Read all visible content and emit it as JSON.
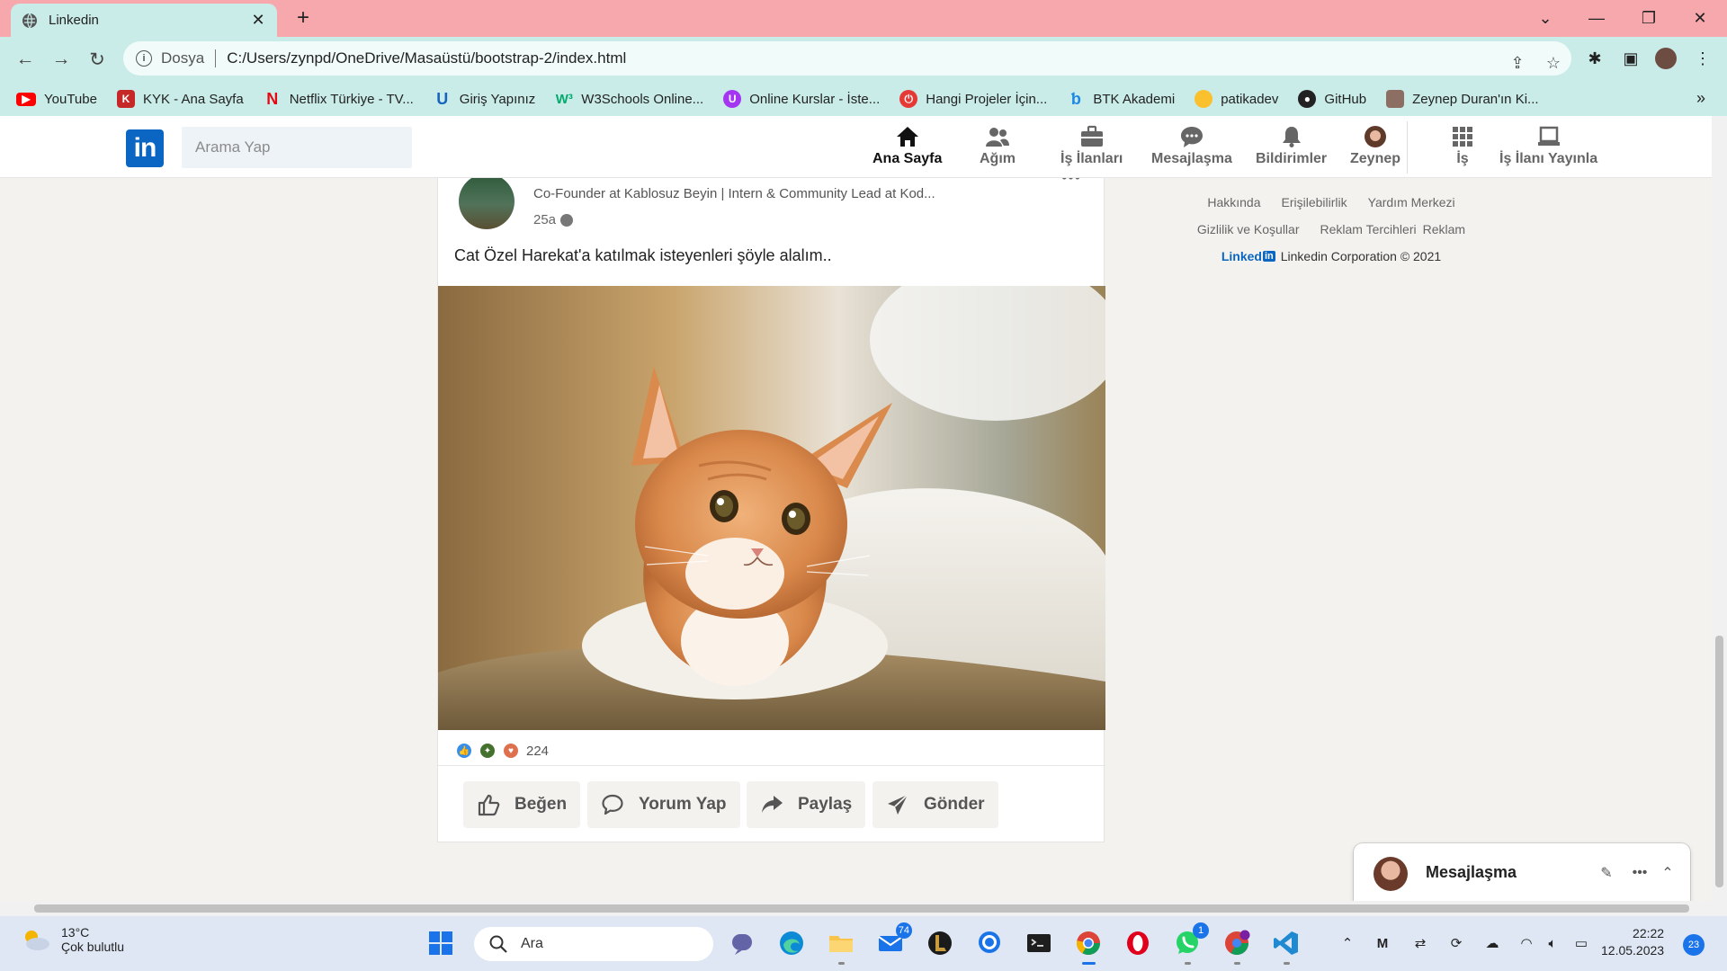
{
  "browser": {
    "tab_title": "Linkedin",
    "address_scheme": "Dosya",
    "address_url": "C:/Users/zynpd/OneDrive/Masaüstü/bootstrap-2/index.html"
  },
  "bookmarks": [
    {
      "label": "YouTube",
      "icon": "youtube-icon",
      "color": "#ff0000"
    },
    {
      "label": "KYK - Ana Sayfa",
      "icon": "kyk-icon",
      "color": "#c62828"
    },
    {
      "label": "Netflix Türkiye - TV...",
      "icon": "netflix-icon",
      "color": "#e50914"
    },
    {
      "label": "Giriş Yapınız",
      "icon": "udemy-icon",
      "color": "#1565c0"
    },
    {
      "label": "W3Schools Online...",
      "icon": "w3schools-icon",
      "color": "#04aa6d"
    },
    {
      "label": "Online Kurslar - İste...",
      "icon": "udemy-purple-icon",
      "color": "#a435f0"
    },
    {
      "label": "Hangi Projeler İçin...",
      "icon": "power-icon",
      "color": "#e53935"
    },
    {
      "label": "BTK Akademi",
      "icon": "btk-icon",
      "color": "#1e88e5"
    },
    {
      "label": "patikadev",
      "icon": "patika-icon",
      "color": "#fbc02d"
    },
    {
      "label": "GitHub",
      "icon": "github-icon",
      "color": "#222222"
    },
    {
      "label": "Zeynep Duran'ın Ki...",
      "icon": "profile-icon",
      "color": "#8d6e63"
    }
  ],
  "linkedin": {
    "search_placeholder": "Arama Yap",
    "nav": [
      {
        "label": "Ana Sayfa",
        "icon": "home-icon"
      },
      {
        "label": "Ağım",
        "icon": "network-icon"
      },
      {
        "label": "İş İlanları",
        "icon": "briefcase-icon"
      },
      {
        "label": "Mesajlaşma",
        "icon": "messaging-icon"
      },
      {
        "label": "Bildirimler",
        "icon": "bell-icon"
      },
      {
        "label": "Zeynep",
        "icon": "avatar-icon"
      },
      {
        "label": "İş",
        "icon": "grid-icon"
      },
      {
        "label": "İş İlanı Yayınla",
        "icon": "laptop-icon"
      }
    ],
    "post": {
      "author_subtitle": "Co-Founder at Kablosuz Beyin | Intern & Community Lead at Kod...",
      "time": "25a",
      "text": "Cat Özel Harekat'a katılmak isteyenleri şöyle alalım..",
      "reaction_count": "224",
      "actions": [
        {
          "label": "Beğen",
          "icon": "like-icon"
        },
        {
          "label": "Yorum Yap",
          "icon": "comment-icon"
        },
        {
          "label": "Paylaş",
          "icon": "share-icon"
        },
        {
          "label": "Gönder",
          "icon": "send-icon"
        }
      ]
    },
    "footer": {
      "links_row1": [
        "Hakkında",
        "Erişilebilirlik",
        "Yardım Merkezi"
      ],
      "links_row2": [
        "Gizlilik ve Koşullar",
        "Reklam Tercihleri",
        "Reklam"
      ],
      "brand": "Linked",
      "brand_in": "in",
      "copyright": "Linkedin Corporation © 2021"
    },
    "messaging_dock": {
      "title": "Mesajlaşma"
    }
  },
  "taskbar": {
    "temperature": "13°C",
    "weather": "Çok bulutlu",
    "search_placeholder": "Ara",
    "mail_badge": "74",
    "whatsapp_badge": "1",
    "time": "22:22",
    "date": "12.05.2023",
    "notification_count": "23"
  },
  "colors": {
    "linkedin_blue": "#0a66c2",
    "tabbar": "#f7a8ad",
    "toolbar": "#c9ece8"
  }
}
